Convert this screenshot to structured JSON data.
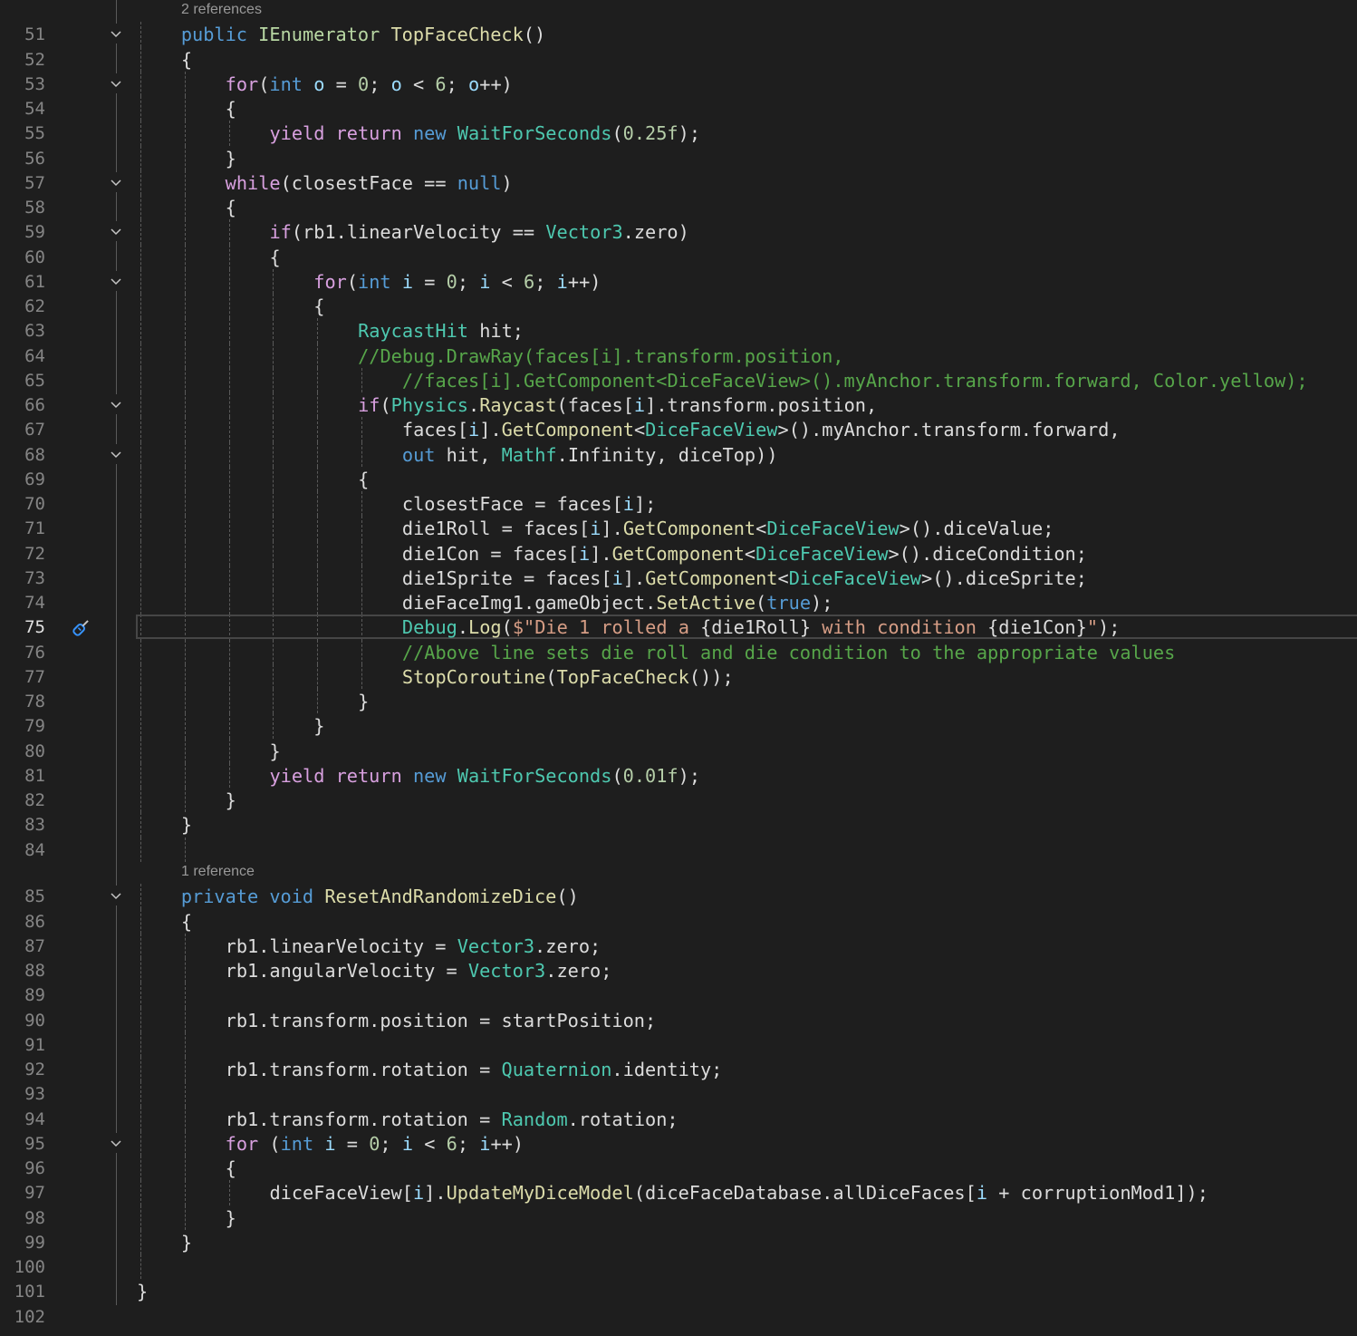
{
  "editor": {
    "current_line": "75",
    "colors": {
      "background": "#1e1e1e",
      "keyword": "#569cd6",
      "control": "#d8a0df",
      "type": "#4ec9b0",
      "method": "#dcdcaa",
      "local": "#9cdcfe",
      "number": "#b5cea8",
      "string": "#d69d85",
      "comment": "#57a64a"
    },
    "breakpoint_icon": "screwdriver-icon",
    "fold_lines": [
      "51",
      "53",
      "57",
      "59",
      "61",
      "66",
      "68",
      "85",
      "95"
    ],
    "lines": [
      {
        "num": "51",
        "lens": "2 references",
        "code": "    public IEnumerator TopFaceCheck()"
      },
      {
        "num": "52",
        "code": "    {"
      },
      {
        "num": "53",
        "code": "        for(int o = 0; o < 6; o++)"
      },
      {
        "num": "54",
        "code": "        {"
      },
      {
        "num": "55",
        "code": "            yield return new WaitForSeconds(0.25f);"
      },
      {
        "num": "56",
        "code": "        }"
      },
      {
        "num": "57",
        "code": "        while(closestFace == null)"
      },
      {
        "num": "58",
        "code": "        {"
      },
      {
        "num": "59",
        "code": "            if(rb1.linearVelocity == Vector3.zero)"
      },
      {
        "num": "60",
        "code": "            {"
      },
      {
        "num": "61",
        "code": "                for(int i = 0; i < 6; i++)"
      },
      {
        "num": "62",
        "code": "                {"
      },
      {
        "num": "63",
        "code": "                    RaycastHit hit;"
      },
      {
        "num": "64",
        "code": "                    //Debug.DrawRay(faces[i].transform.position,"
      },
      {
        "num": "65",
        "code": "                        //faces[i].GetComponent<DiceFaceView>().myAnchor.transform.forward, Color.yellow);"
      },
      {
        "num": "66",
        "code": "                    if(Physics.Raycast(faces[i].transform.position,"
      },
      {
        "num": "67",
        "code": "                        faces[i].GetComponent<DiceFaceView>().myAnchor.transform.forward,"
      },
      {
        "num": "68",
        "code": "                        out hit, Mathf.Infinity, diceTop))"
      },
      {
        "num": "69",
        "code": "                    {"
      },
      {
        "num": "70",
        "code": "                        closestFace = faces[i];"
      },
      {
        "num": "71",
        "code": "                        die1Roll = faces[i].GetComponent<DiceFaceView>().diceValue;"
      },
      {
        "num": "72",
        "code": "                        die1Con = faces[i].GetComponent<DiceFaceView>().diceCondition;"
      },
      {
        "num": "73",
        "code": "                        die1Sprite = faces[i].GetComponent<DiceFaceView>().diceSprite;"
      },
      {
        "num": "74",
        "code": "                        dieFaceImg1.gameObject.SetActive(true);"
      },
      {
        "num": "75",
        "code": "                        Debug.Log($\"Die 1 rolled a {die1Roll} with condition {die1Con}\");"
      },
      {
        "num": "76",
        "code": "                        //Above line sets die roll and die condition to the appropriate values"
      },
      {
        "num": "77",
        "code": "                        StopCoroutine(TopFaceCheck());"
      },
      {
        "num": "78",
        "code": "                    }"
      },
      {
        "num": "79",
        "code": "                }"
      },
      {
        "num": "80",
        "code": "            }"
      },
      {
        "num": "81",
        "code": "            yield return new WaitForSeconds(0.01f);"
      },
      {
        "num": "82",
        "code": "        }"
      },
      {
        "num": "83",
        "code": "    }"
      },
      {
        "num": "84",
        "code": ""
      },
      {
        "num": "85",
        "lens": "1 reference",
        "code": "    private void ResetAndRandomizeDice()"
      },
      {
        "num": "86",
        "code": "    {"
      },
      {
        "num": "87",
        "code": "        rb1.linearVelocity = Vector3.zero;"
      },
      {
        "num": "88",
        "code": "        rb1.angularVelocity = Vector3.zero;"
      },
      {
        "num": "89",
        "code": ""
      },
      {
        "num": "90",
        "code": "        rb1.transform.position = startPosition;"
      },
      {
        "num": "91",
        "code": ""
      },
      {
        "num": "92",
        "code": "        rb1.transform.rotation = Quaternion.identity;"
      },
      {
        "num": "93",
        "code": ""
      },
      {
        "num": "94",
        "code": "        rb1.transform.rotation = Random.rotation;"
      },
      {
        "num": "95",
        "code": "        for (int i = 0; i < 6; i++)"
      },
      {
        "num": "96",
        "code": "        {"
      },
      {
        "num": "97",
        "code": "            diceFaceView[i].UpdateMyDiceModel(diceFaceDatabase.allDiceFaces[i + corruptionMod1]);"
      },
      {
        "num": "98",
        "code": "        }"
      },
      {
        "num": "99",
        "code": "    }"
      },
      {
        "num": "100",
        "code": ""
      },
      {
        "num": "101",
        "code": "}"
      },
      {
        "num": "102",
        "code": ""
      }
    ]
  }
}
